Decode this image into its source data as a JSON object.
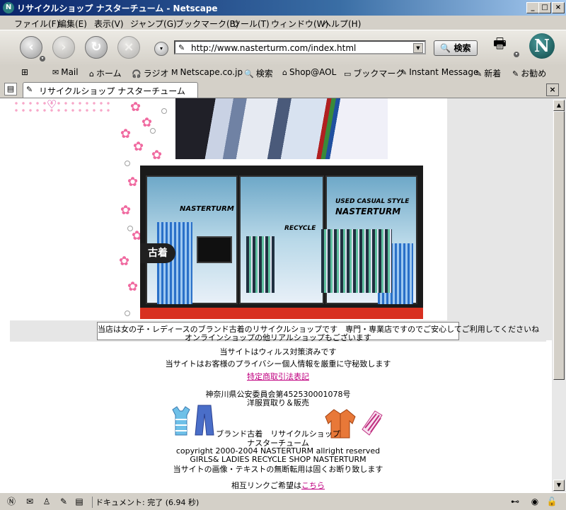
{
  "window": {
    "title": "リサイクルショップ ナスターチューム - Netscape"
  },
  "menu": [
    "ファイル(F)",
    "編集(E)",
    "表示(V)",
    "ジャンプ(G)",
    "ブックマーク(B)",
    "ツール(T)",
    "ウィンドウ(W)",
    "ヘルプ(H)"
  ],
  "nav": {
    "url": "http://www.nasterturm.com/index.html",
    "search_label": "検索"
  },
  "personal_toolbar": [
    "Mail",
    "ホーム",
    "ラジオ",
    "Netscape.co.jp",
    "検索",
    "Shop@AOL",
    "ブックマーク",
    "Instant Message",
    "新着",
    "お勧め"
  ],
  "tab": {
    "label": "リサイクルショップ ナスターチューム"
  },
  "content": {
    "furugi": "古着",
    "shop_sign": "NASTERTURM",
    "shop_sign_2": "USED CASUAL STYLE",
    "recycle_sign": "RECYCLE",
    "notice_line1": "当店は女の子・レディースのブランド古着のリサイクルショップです　専門・専業店ですのでご安心してご利用してくださいね",
    "notice_line2": "オンラインショップの他リアルショップもございます",
    "virus": "当サイトはウィルス対策済みです",
    "privacy": "当サイトはお客様のプライバシー個人情報を厳重に守秘致します",
    "law_link": "特定商取引法表記",
    "license": "神奈川県公安委員会第452530001078号",
    "business": "洋服買取り＆販売",
    "brand": "ブランド古着　リサイクルショップ",
    "shop_name": "ナスターチューム",
    "copyright": "copyright  2000-2004  NASTERTURM  allright  reserved",
    "girls": "GIRLS&  LADIES  RECYCLE  SHOP  NASTERTURM",
    "no_copy": "当サイトの画像・テキストの無断転用は固くお断り致します",
    "link_prefix": "相互リンクご希望は",
    "link_here": "こちら"
  },
  "status": {
    "text": "ドキュメント: 完了 (6.94 秒)"
  }
}
